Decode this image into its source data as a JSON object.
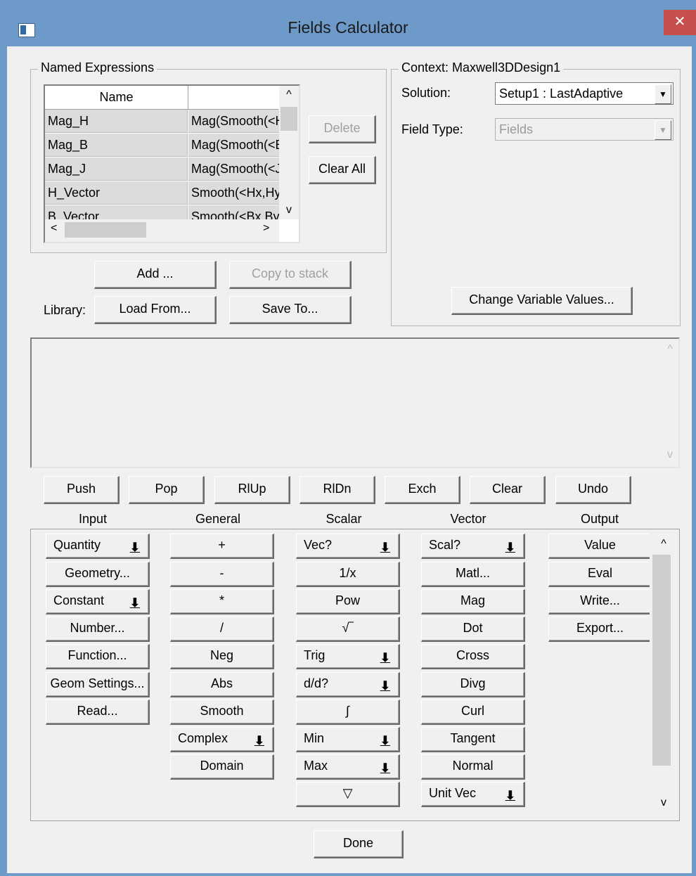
{
  "window": {
    "title": "Fields Calculator",
    "close_glyph": "✕"
  },
  "named_expressions": {
    "group_label": "Named Expressions",
    "columns": [
      "Name",
      ""
    ],
    "rows": [
      {
        "name": "Mag_H",
        "expr": "Mag(Smooth(<H"
      },
      {
        "name": "Mag_B",
        "expr": "Mag(Smooth(<B"
      },
      {
        "name": "Mag_J",
        "expr": "Mag(Smooth(<J"
      },
      {
        "name": "H_Vector",
        "expr": "Smooth(<Hx,Hy"
      },
      {
        "name": "B_Vector",
        "expr": "Smooth(<Bx,By"
      }
    ],
    "delete_label": "Delete",
    "clear_all_label": "Clear All"
  },
  "library": {
    "add_label": "Add ...",
    "copy_to_stack_label": "Copy to stack",
    "library_label": "Library:",
    "load_from_label": "Load From...",
    "save_to_label": "Save To..."
  },
  "context": {
    "group_label": "Context: Maxwell3DDesign1",
    "solution_label": "Solution:",
    "solution_value": "Setup1 : LastAdaptive",
    "field_type_label": "Field Type:",
    "field_type_value": "Fields",
    "change_variable_label": "Change Variable Values..."
  },
  "stack_buttons": [
    "Push",
    "Pop",
    "RlUp",
    "RlDn",
    "Exch",
    "Clear",
    "Undo"
  ],
  "columns": {
    "input": {
      "title": "Input",
      "buttons": [
        {
          "label": "Quantity",
          "arrow": true
        },
        {
          "label": "Geometry...",
          "arrow": false
        },
        {
          "label": "Constant",
          "arrow": true
        },
        {
          "label": "Number...",
          "arrow": false
        },
        {
          "label": "Function...",
          "arrow": false
        },
        {
          "label": "Geom Settings...",
          "arrow": false
        },
        {
          "label": "Read...",
          "arrow": false
        }
      ]
    },
    "general": {
      "title": "General",
      "buttons": [
        {
          "label": "+",
          "arrow": false
        },
        {
          "label": "-",
          "arrow": false
        },
        {
          "label": "*",
          "arrow": false
        },
        {
          "label": "/",
          "arrow": false
        },
        {
          "label": "Neg",
          "arrow": false
        },
        {
          "label": "Abs",
          "arrow": false
        },
        {
          "label": "Smooth",
          "arrow": false
        },
        {
          "label": "Complex",
          "arrow": true
        },
        {
          "label": "Domain",
          "arrow": false
        }
      ]
    },
    "scalar": {
      "title": "Scalar",
      "buttons": [
        {
          "label": "Vec?",
          "arrow": true
        },
        {
          "label": "1/x",
          "arrow": false
        },
        {
          "label": "Pow",
          "arrow": false
        },
        {
          "label": "√‾",
          "arrow": false
        },
        {
          "label": "Trig",
          "arrow": true
        },
        {
          "label": "d/d?",
          "arrow": true
        },
        {
          "label": "∫",
          "arrow": false
        },
        {
          "label": "Min",
          "arrow": true
        },
        {
          "label": "Max",
          "arrow": true
        },
        {
          "label": "▽",
          "arrow": false
        }
      ]
    },
    "vector": {
      "title": "Vector",
      "buttons": [
        {
          "label": "Scal?",
          "arrow": true
        },
        {
          "label": "Matl...",
          "arrow": false
        },
        {
          "label": "Mag",
          "arrow": false
        },
        {
          "label": "Dot",
          "arrow": false
        },
        {
          "label": "Cross",
          "arrow": false
        },
        {
          "label": "Divg",
          "arrow": false
        },
        {
          "label": "Curl",
          "arrow": false
        },
        {
          "label": "Tangent",
          "arrow": false
        },
        {
          "label": "Normal",
          "arrow": false
        },
        {
          "label": "Unit Vec",
          "arrow": true
        }
      ]
    },
    "output": {
      "title": "Output",
      "buttons": [
        {
          "label": "Value",
          "arrow": false
        },
        {
          "label": "Eval",
          "arrow": false
        },
        {
          "label": "Write...",
          "arrow": false
        },
        {
          "label": "Export...",
          "arrow": false
        }
      ]
    }
  },
  "done_label": "Done",
  "glyphs": {
    "up": "^",
    "down": "v",
    "left": "<",
    "right": ">",
    "dropdown": "▼",
    "arrow_down": "⬇"
  }
}
